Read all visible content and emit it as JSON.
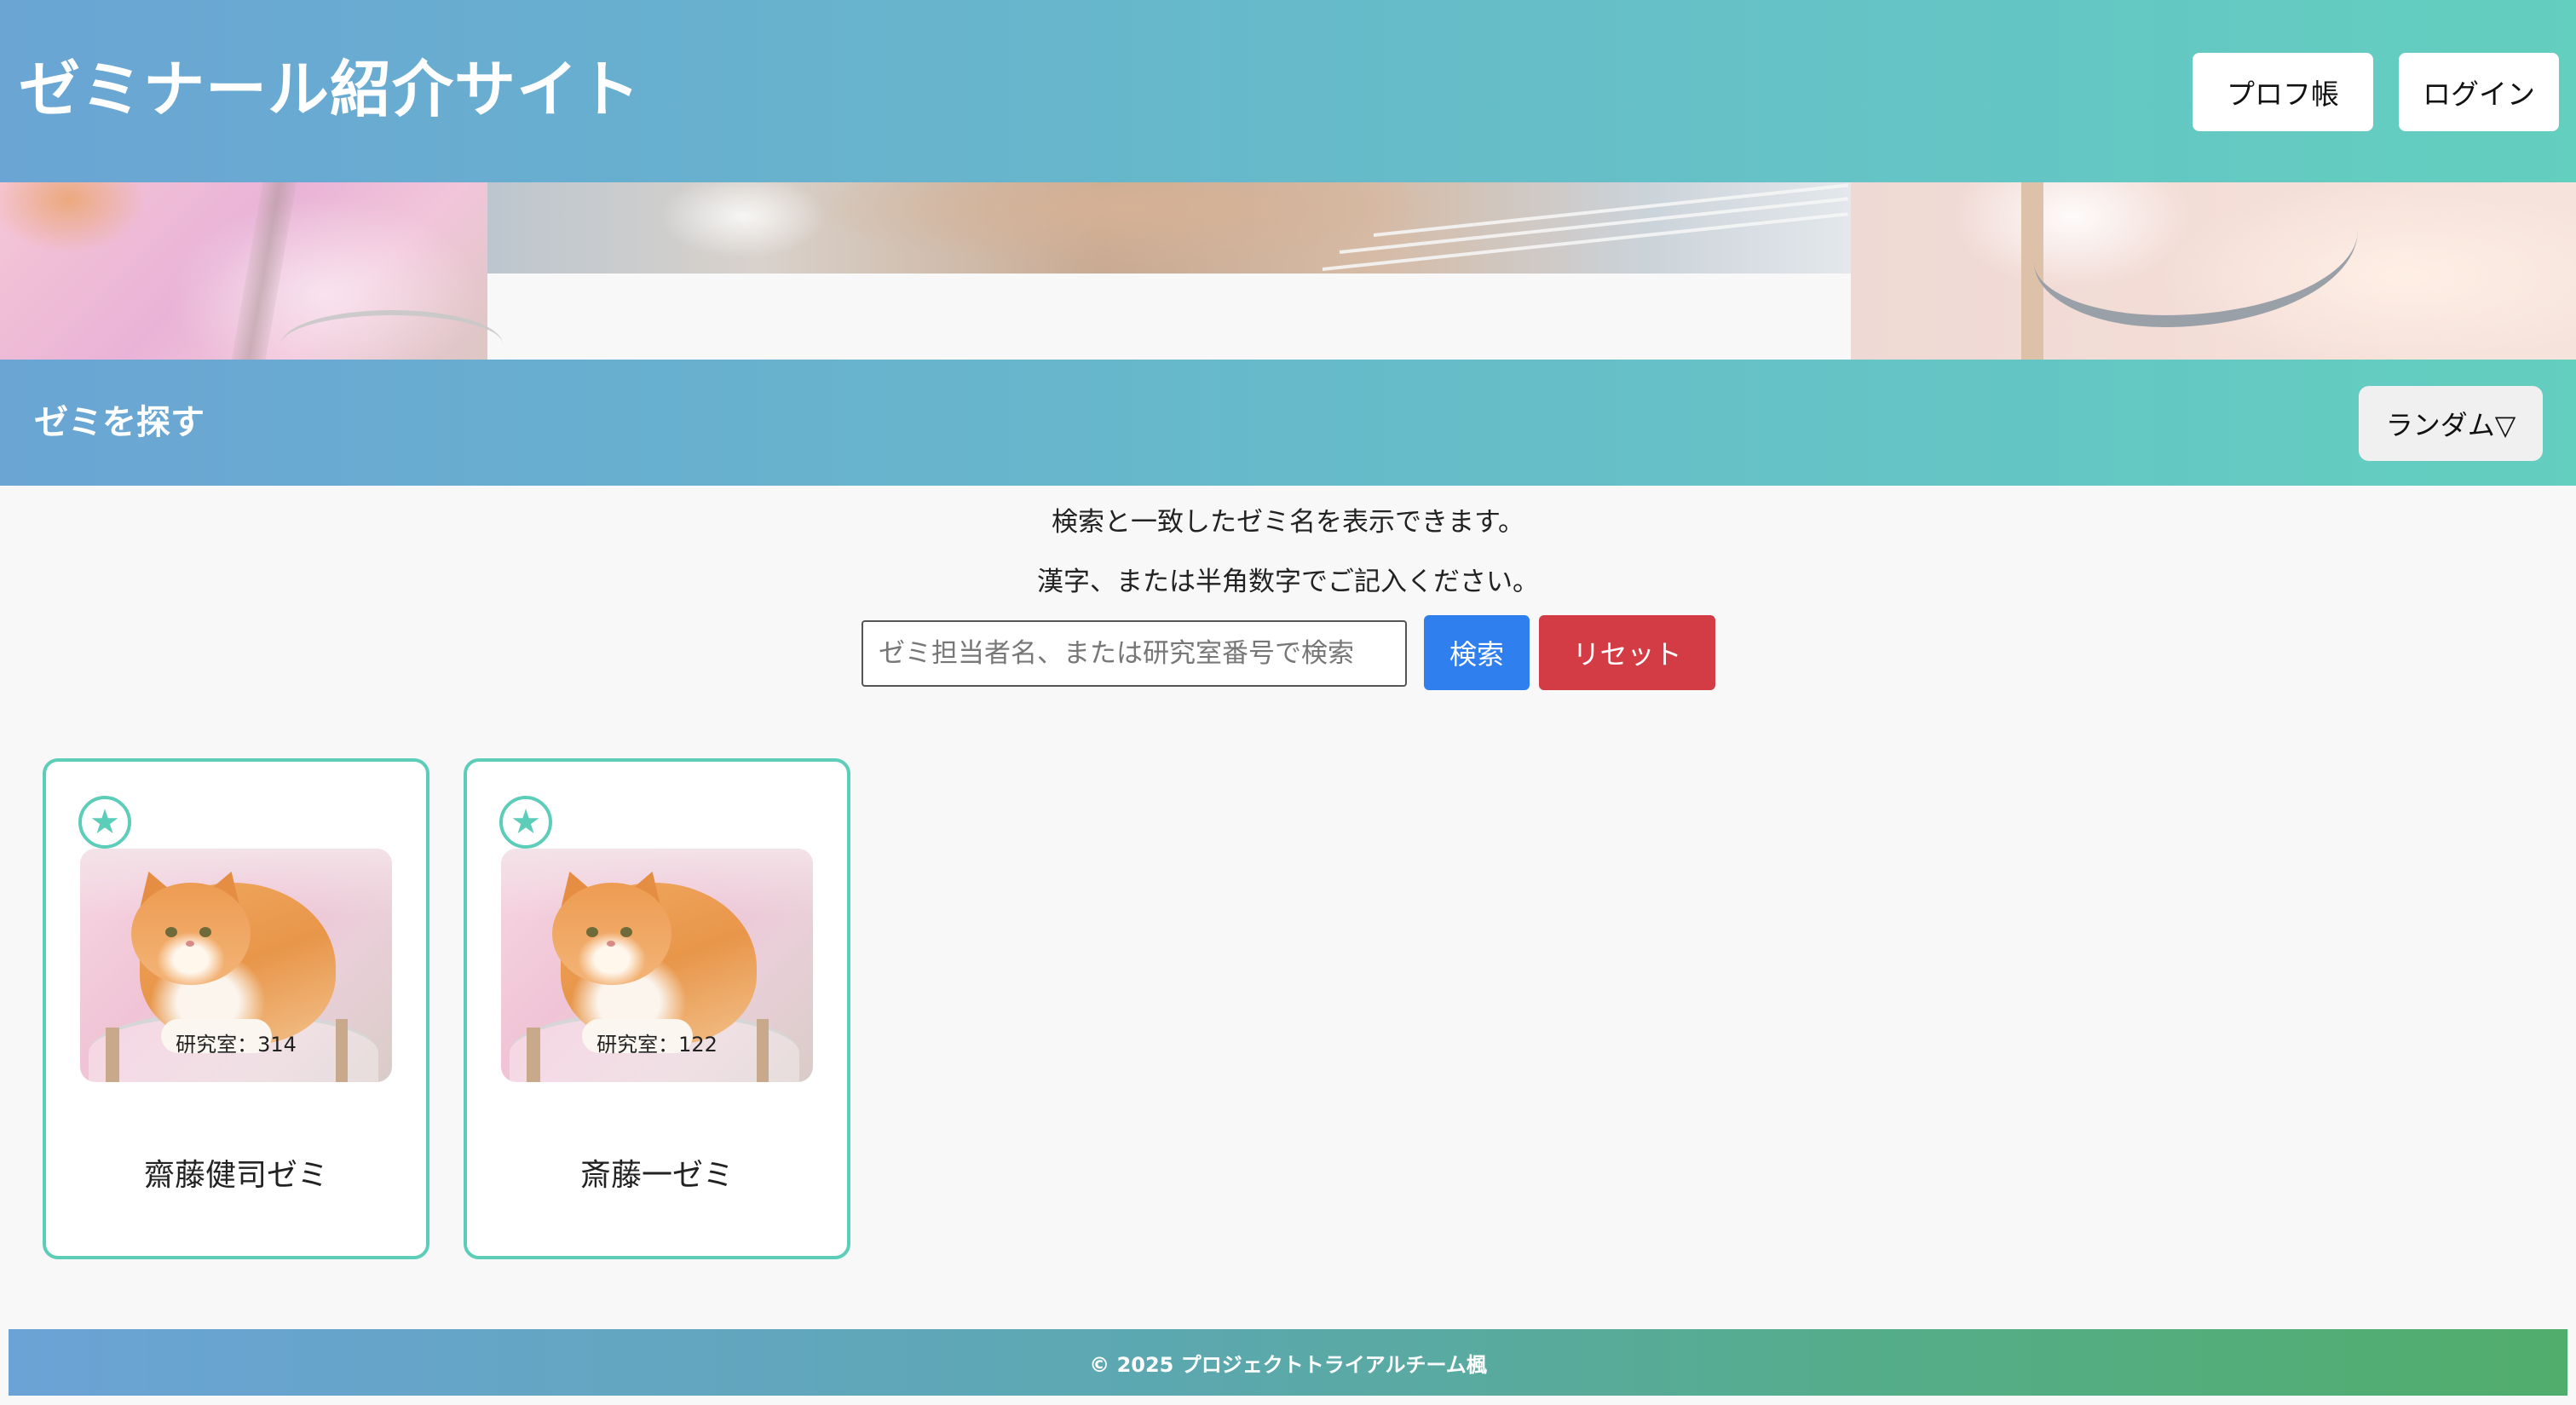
{
  "header": {
    "site_title": "ゼミナール紹介サイト",
    "prof_button": "プロフ帳",
    "login_button": "ログイン"
  },
  "search_section": {
    "title": "ゼミを探す",
    "sort_button": "ランダム▽",
    "description_1": "検索と一致したゼミ名を表示できます。",
    "description_2": "漢字、または半角数字でご記入ください。",
    "input_placeholder": "ゼミ担当者名、または研究室番号で検索",
    "input_value": "",
    "search_button": "検索",
    "reset_button": "リセット"
  },
  "cards": [
    {
      "favorite_icon": "star-icon",
      "room": "研究室：314",
      "name": "齋藤健司ゼミ"
    },
    {
      "favorite_icon": "star-icon",
      "room": "研究室：122",
      "name": "斎藤一ゼミ"
    }
  ],
  "footer": {
    "copyright": "© 2025 プロジェクトトライアルチーム楓"
  },
  "colors": {
    "header_gradient_start": "#6aa5d4",
    "header_gradient_end": "#63cfbf",
    "card_border": "#5ccdb8",
    "search_button": "#2f7fee",
    "reset_button": "#d33c45",
    "footer_gradient_end": "#51ad6c"
  }
}
